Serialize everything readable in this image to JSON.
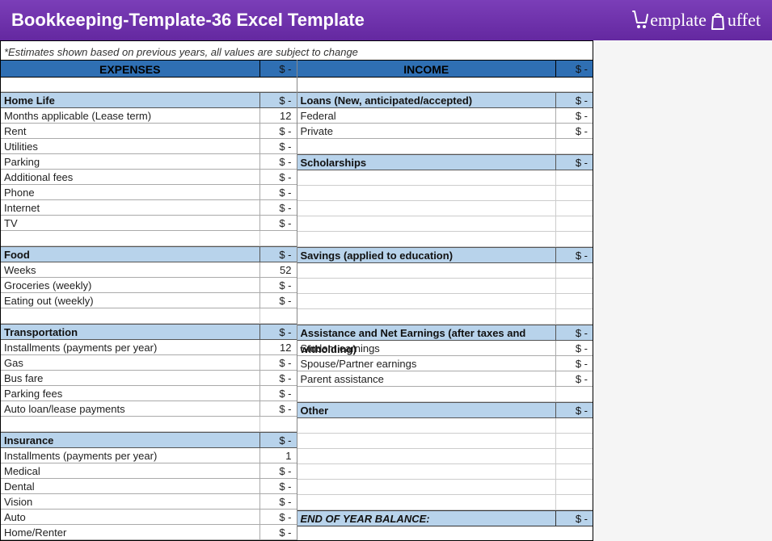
{
  "header": {
    "title": "Bookkeeping-Template-36 Excel Template",
    "logo_left": "emplate",
    "logo_right": "uffet"
  },
  "note": "*Estimates shown based on previous years, all values are subject to change",
  "expenses": {
    "title": "EXPENSES",
    "total": "$ -",
    "sections": [
      {
        "title": "Home Life",
        "total": "$ -",
        "rows": [
          {
            "label": "Months applicable (Lease term)",
            "val": "12"
          },
          {
            "label": "Rent",
            "val": "$ -"
          },
          {
            "label": "Utilities",
            "val": "$ -"
          },
          {
            "label": "Parking",
            "val": "$ -"
          },
          {
            "label": "Additional fees",
            "val": "$ -"
          },
          {
            "label": "Phone",
            "val": "$ -"
          },
          {
            "label": "Internet",
            "val": "$ -"
          },
          {
            "label": "TV",
            "val": "$ -"
          }
        ]
      },
      {
        "title": "Food",
        "total": "$ -",
        "rows": [
          {
            "label": "Weeks",
            "val": "52"
          },
          {
            "label": "Groceries (weekly)",
            "val": "$ -"
          },
          {
            "label": "Eating out (weekly)",
            "val": "$ -"
          }
        ]
      },
      {
        "title": "Transportation",
        "total": "$ -",
        "rows": [
          {
            "label": "Installments (payments per year)",
            "val": "12"
          },
          {
            "label": "Gas",
            "val": "$ -"
          },
          {
            "label": "Bus fare",
            "val": "$ -"
          },
          {
            "label": "Parking fees",
            "val": "$ -"
          },
          {
            "label": "Auto loan/lease payments",
            "val": "$ -"
          }
        ]
      },
      {
        "title": "Insurance",
        "total": "$ -",
        "rows": [
          {
            "label": "Installments (payments per year)",
            "val": "1"
          },
          {
            "label": "Medical",
            "val": "$ -"
          },
          {
            "label": "Dental",
            "val": "$ -"
          },
          {
            "label": "Vision",
            "val": "$ -"
          },
          {
            "label": "Auto",
            "val": "$ -"
          },
          {
            "label": "Home/Renter",
            "val": "$ -"
          }
        ]
      }
    ]
  },
  "income": {
    "title": "INCOME",
    "total": "$ -",
    "sections": [
      {
        "title": "Loans (New, anticipated/accepted)",
        "total": "$ -",
        "rows": [
          {
            "label": "Federal",
            "val": "$ -"
          },
          {
            "label": "Private",
            "val": "$ -"
          },
          {
            "label": "",
            "val": ""
          }
        ]
      },
      {
        "title": "Scholarships",
        "total": "$ -",
        "rows": [
          {
            "label": "",
            "val": ""
          },
          {
            "label": "",
            "val": ""
          },
          {
            "label": "",
            "val": ""
          }
        ]
      },
      {
        "title": "Savings (applied to education)",
        "total": "$ -",
        "rows": [
          {
            "label": "",
            "val": ""
          },
          {
            "label": "",
            "val": ""
          },
          {
            "label": "",
            "val": ""
          }
        ]
      },
      {
        "title": "Assistance and Net Earnings (after taxes and witholding)",
        "total": "$ -",
        "rows": [
          {
            "label": "Student earnings",
            "val": "$ -"
          },
          {
            "label": "Spouse/Partner earnings",
            "val": "$ -"
          },
          {
            "label": "Parent assistance",
            "val": "$ -"
          },
          {
            "label": "",
            "val": ""
          }
        ]
      },
      {
        "title": "Other",
        "total": "$ -",
        "rows": [
          {
            "label": "",
            "val": ""
          },
          {
            "label": "",
            "val": ""
          },
          {
            "label": "",
            "val": ""
          }
        ]
      }
    ],
    "end": {
      "label": "END OF YEAR BALANCE:",
      "val": "$ -"
    }
  }
}
